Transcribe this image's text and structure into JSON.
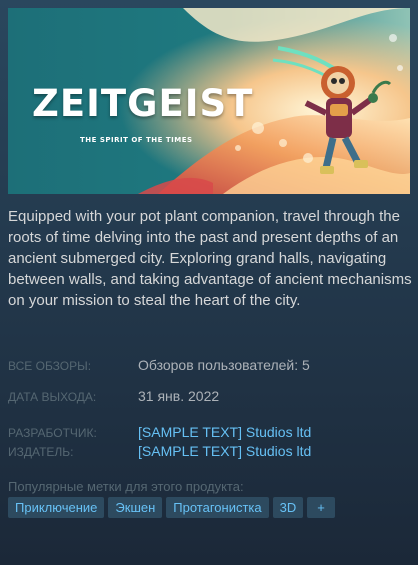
{
  "game": {
    "title": "ZEITGEIST",
    "subtitle": "THE SPIRIT OF THE TIMES",
    "description": "Equipped with your pot plant companion, travel through the roots of time delving into the past and present depths of an ancient submerged city. Exploring grand halls, navigating between walls, and taking advantage of ancient mechanisms on your mission to steal the heart of the city."
  },
  "info": {
    "reviews_label": "ВСЕ ОБЗОРЫ:",
    "reviews_value": "Обзоров пользователей: 5",
    "release_label": "ДАТА ВЫХОДА:",
    "release_value": "31 янв. 2022",
    "developer_label": "РАЗРАБОТЧИК:",
    "developer_value": "[SAMPLE TEXT] Studios ltd",
    "publisher_label": "ИЗДАТЕЛЬ:",
    "publisher_value": "[SAMPLE TEXT] Studios ltd"
  },
  "tags": {
    "label": "Популярные метки для этого продукта:",
    "items": [
      "Приключение",
      "Экшен",
      "Протагонистка",
      "3D"
    ],
    "add_label": "+"
  },
  "colors": {
    "panel_top": "#2a475e",
    "panel_bottom": "#1b2838",
    "link": "#66c0f4",
    "tag_bg": "#2d4a5f",
    "label": "#556772",
    "text": "#d6d7d8"
  },
  "icons": {
    "header": "game-header-art"
  }
}
